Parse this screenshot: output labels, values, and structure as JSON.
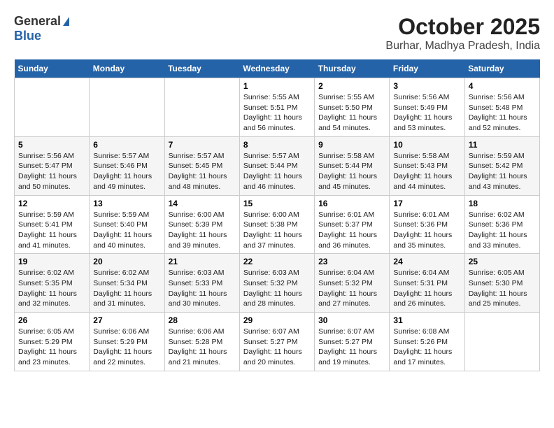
{
  "header": {
    "logo_general": "General",
    "logo_blue": "Blue",
    "month_title": "October 2025",
    "location": "Burhar, Madhya Pradesh, India"
  },
  "days_of_week": [
    "Sunday",
    "Monday",
    "Tuesday",
    "Wednesday",
    "Thursday",
    "Friday",
    "Saturday"
  ],
  "weeks": [
    [
      {
        "day": "",
        "info": ""
      },
      {
        "day": "",
        "info": ""
      },
      {
        "day": "",
        "info": ""
      },
      {
        "day": "1",
        "info": "Sunrise: 5:55 AM\nSunset: 5:51 PM\nDaylight: 11 hours\nand 56 minutes."
      },
      {
        "day": "2",
        "info": "Sunrise: 5:55 AM\nSunset: 5:50 PM\nDaylight: 11 hours\nand 54 minutes."
      },
      {
        "day": "3",
        "info": "Sunrise: 5:56 AM\nSunset: 5:49 PM\nDaylight: 11 hours\nand 53 minutes."
      },
      {
        "day": "4",
        "info": "Sunrise: 5:56 AM\nSunset: 5:48 PM\nDaylight: 11 hours\nand 52 minutes."
      }
    ],
    [
      {
        "day": "5",
        "info": "Sunrise: 5:56 AM\nSunset: 5:47 PM\nDaylight: 11 hours\nand 50 minutes."
      },
      {
        "day": "6",
        "info": "Sunrise: 5:57 AM\nSunset: 5:46 PM\nDaylight: 11 hours\nand 49 minutes."
      },
      {
        "day": "7",
        "info": "Sunrise: 5:57 AM\nSunset: 5:45 PM\nDaylight: 11 hours\nand 48 minutes."
      },
      {
        "day": "8",
        "info": "Sunrise: 5:57 AM\nSunset: 5:44 PM\nDaylight: 11 hours\nand 46 minutes."
      },
      {
        "day": "9",
        "info": "Sunrise: 5:58 AM\nSunset: 5:44 PM\nDaylight: 11 hours\nand 45 minutes."
      },
      {
        "day": "10",
        "info": "Sunrise: 5:58 AM\nSunset: 5:43 PM\nDaylight: 11 hours\nand 44 minutes."
      },
      {
        "day": "11",
        "info": "Sunrise: 5:59 AM\nSunset: 5:42 PM\nDaylight: 11 hours\nand 43 minutes."
      }
    ],
    [
      {
        "day": "12",
        "info": "Sunrise: 5:59 AM\nSunset: 5:41 PM\nDaylight: 11 hours\nand 41 minutes."
      },
      {
        "day": "13",
        "info": "Sunrise: 5:59 AM\nSunset: 5:40 PM\nDaylight: 11 hours\nand 40 minutes."
      },
      {
        "day": "14",
        "info": "Sunrise: 6:00 AM\nSunset: 5:39 PM\nDaylight: 11 hours\nand 39 minutes."
      },
      {
        "day": "15",
        "info": "Sunrise: 6:00 AM\nSunset: 5:38 PM\nDaylight: 11 hours\nand 37 minutes."
      },
      {
        "day": "16",
        "info": "Sunrise: 6:01 AM\nSunset: 5:37 PM\nDaylight: 11 hours\nand 36 minutes."
      },
      {
        "day": "17",
        "info": "Sunrise: 6:01 AM\nSunset: 5:36 PM\nDaylight: 11 hours\nand 35 minutes."
      },
      {
        "day": "18",
        "info": "Sunrise: 6:02 AM\nSunset: 5:36 PM\nDaylight: 11 hours\nand 33 minutes."
      }
    ],
    [
      {
        "day": "19",
        "info": "Sunrise: 6:02 AM\nSunset: 5:35 PM\nDaylight: 11 hours\nand 32 minutes."
      },
      {
        "day": "20",
        "info": "Sunrise: 6:02 AM\nSunset: 5:34 PM\nDaylight: 11 hours\nand 31 minutes."
      },
      {
        "day": "21",
        "info": "Sunrise: 6:03 AM\nSunset: 5:33 PM\nDaylight: 11 hours\nand 30 minutes."
      },
      {
        "day": "22",
        "info": "Sunrise: 6:03 AM\nSunset: 5:32 PM\nDaylight: 11 hours\nand 28 minutes."
      },
      {
        "day": "23",
        "info": "Sunrise: 6:04 AM\nSunset: 5:32 PM\nDaylight: 11 hours\nand 27 minutes."
      },
      {
        "day": "24",
        "info": "Sunrise: 6:04 AM\nSunset: 5:31 PM\nDaylight: 11 hours\nand 26 minutes."
      },
      {
        "day": "25",
        "info": "Sunrise: 6:05 AM\nSunset: 5:30 PM\nDaylight: 11 hours\nand 25 minutes."
      }
    ],
    [
      {
        "day": "26",
        "info": "Sunrise: 6:05 AM\nSunset: 5:29 PM\nDaylight: 11 hours\nand 23 minutes."
      },
      {
        "day": "27",
        "info": "Sunrise: 6:06 AM\nSunset: 5:29 PM\nDaylight: 11 hours\nand 22 minutes."
      },
      {
        "day": "28",
        "info": "Sunrise: 6:06 AM\nSunset: 5:28 PM\nDaylight: 11 hours\nand 21 minutes."
      },
      {
        "day": "29",
        "info": "Sunrise: 6:07 AM\nSunset: 5:27 PM\nDaylight: 11 hours\nand 20 minutes."
      },
      {
        "day": "30",
        "info": "Sunrise: 6:07 AM\nSunset: 5:27 PM\nDaylight: 11 hours\nand 19 minutes."
      },
      {
        "day": "31",
        "info": "Sunrise: 6:08 AM\nSunset: 5:26 PM\nDaylight: 11 hours\nand 17 minutes."
      },
      {
        "day": "",
        "info": ""
      }
    ]
  ]
}
